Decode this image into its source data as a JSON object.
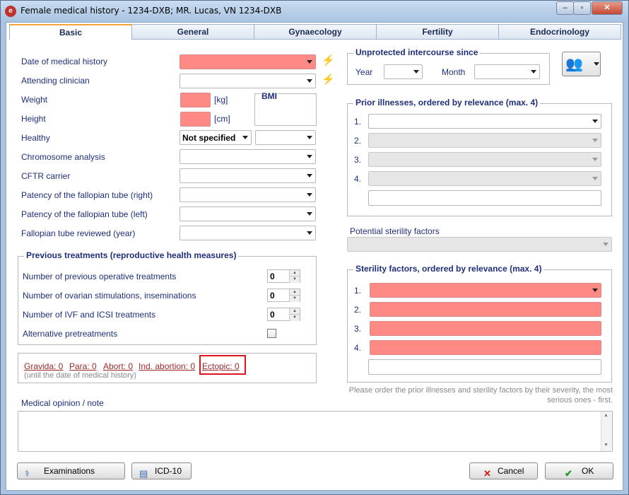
{
  "window": {
    "title": "Female medical history - 1234-DXB; MR. Lucas, VN 1234-DXB",
    "minimize_glyph": "–",
    "maximize_glyph": "▫",
    "close_glyph": "✕",
    "app_icon_glyph": "e"
  },
  "tabs": [
    "Basic",
    "General",
    "Gynaecology",
    "Fertility",
    "Endocrinology"
  ],
  "left": {
    "date_label": "Date of medical history",
    "clinician_label": "Attending clinician",
    "weight_label": "Weight",
    "weight_unit": "[kg]",
    "height_label": "Height",
    "height_unit": "[cm]",
    "bmi_label": "BMI",
    "healthy_label": "Healthy",
    "healthy_value": "Not specified",
    "chromosome_label": "Chromosome analysis",
    "cftr_label": "CFTR carrier",
    "patency_right_label": "Patency of the fallopian tube (right)",
    "patency_left_label": "Patency of the fallopian tube (left)",
    "reviewed_label": "Fallopian tube reviewed (year)"
  },
  "previous_treatments": {
    "title": "Previous treatments (reproductive health measures)",
    "operative_label": "Number of previous operative treatments",
    "operative_value": "0",
    "stimulations_label": "Number of ovarian stimulations, inseminations",
    "stimulations_value": "0",
    "ivf_label": "Number of IVF and ICSI treatments",
    "ivf_value": "0",
    "alternative_label": "Alternative pretreatments"
  },
  "obstetric": {
    "gravida": "Gravida: 0",
    "para": "Para: 0",
    "abort": "Abort: 0",
    "ind_abortion": "Ind. abortion: 0",
    "ectopic": "Ectopic: 0",
    "note": "(until the date of medical history)"
  },
  "intercourse": {
    "title": "Unprotected intercourse since",
    "year_label": "Year",
    "month_label": "Month"
  },
  "prior_illnesses": {
    "title": "Prior illnesses, ordered by relevance (max. 4)",
    "numbers": [
      "1.",
      "2.",
      "3.",
      "4."
    ]
  },
  "potential_label": "Potential sterility factors",
  "sterility": {
    "title": "Sterility factors, ordered by relevance (max. 4)",
    "numbers": [
      "1.",
      "2.",
      "3.",
      "4."
    ]
  },
  "order_hint": "Please order the prior illnesses and sterility factors by their severity, the most serious ones - first.",
  "opinion_label": "Medical opinion / note",
  "buttons": {
    "examinations": "Examinations",
    "icd10": "ICD-10",
    "cancel": "Cancel",
    "ok": "OK"
  },
  "colors": {
    "required_field": "#ff8a85",
    "label_text": "#1f2e7a",
    "link_text": "#9a2a2a",
    "highlight_box": "#e0141e",
    "active_tab_accent": "#f2a33a"
  }
}
